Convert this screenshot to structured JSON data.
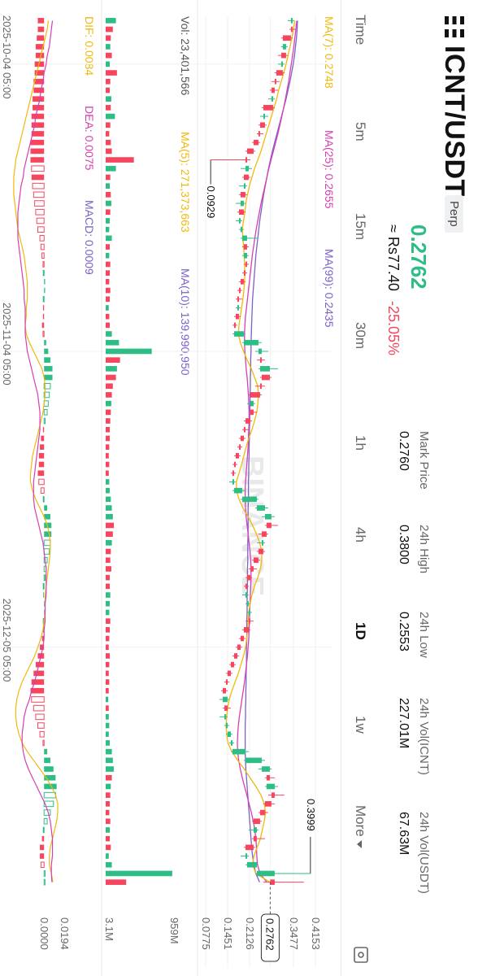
{
  "header": {
    "pair": "ICNT/USDT",
    "contract_type": "Perp",
    "last_price": "0.2762",
    "fiat_price": "≈ Rs77.40",
    "change_pct": "-25.05%"
  },
  "stats": [
    {
      "label": "Mark Price",
      "value": "0.2760"
    },
    {
      "label": "24h High",
      "value": "0.3800"
    },
    {
      "label": "24h Low",
      "value": "0.2553"
    },
    {
      "label": "24h Vol(ICNT)",
      "value": "227.01M"
    },
    {
      "label": "24h Vol(USDT)",
      "value": "67.63M"
    }
  ],
  "timeframes": [
    "Time",
    "5m",
    "15m",
    "30m",
    "1h",
    "4h",
    "1D",
    "1w",
    "More"
  ],
  "active_timeframe": "1D",
  "indicators": {
    "ma7": "MA(7): 0.2748",
    "ma25": "MA(25): 0.2655",
    "ma99": "MA(99): 0.2435",
    "vol": "Vol: 23,401,566",
    "vol_ma5": "MA(5): 271,373,663",
    "vol_ma10": "MA(10): 139,990,950",
    "dif": "DIF: 0.0084",
    "dea": "DEA: 0.0075",
    "macd": "MACD: 0.0009"
  },
  "watermark": "BINANCE",
  "colors": {
    "up": "#2ebd85",
    "down": "#f6465d",
    "ma7": "#f0b90b",
    "ma25": "#d63fb4",
    "ma99": "#7b61c9"
  },
  "chart_data": {
    "type": "candlestick",
    "x_ticks": [
      "2025-10-04 05:00",
      "2025-11-04 05:00",
      "2025-12-05 05:00"
    ],
    "price_ticks": [
      "0.4153",
      "0.3477",
      "0.2762",
      "0.2126",
      "0.1451",
      "0.0775"
    ],
    "price_ylim": [
      0.0775,
      0.4153
    ],
    "volume_ticks": [
      "959M",
      "3.1M"
    ],
    "macd_ticks": [
      "0.0194",
      "0.0000"
    ],
    "annotations": {
      "low": "0.0929",
      "high": "0.3999",
      "last": "0.2762"
    },
    "candles": [
      [
        0.34,
        0.35,
        0.33,
        0.345
      ],
      [
        0.345,
        0.355,
        0.335,
        0.34
      ],
      [
        0.34,
        0.345,
        0.31,
        0.315
      ],
      [
        0.315,
        0.33,
        0.31,
        0.325
      ],
      [
        0.325,
        0.33,
        0.3,
        0.31
      ],
      [
        0.31,
        0.32,
        0.3,
        0.315
      ],
      [
        0.315,
        0.32,
        0.29,
        0.295
      ],
      [
        0.295,
        0.305,
        0.28,
        0.29
      ],
      [
        0.29,
        0.3,
        0.275,
        0.28
      ],
      [
        0.28,
        0.29,
        0.27,
        0.285
      ],
      [
        0.285,
        0.29,
        0.25,
        0.255
      ],
      [
        0.255,
        0.27,
        0.245,
        0.26
      ],
      [
        0.26,
        0.265,
        0.24,
        0.245
      ],
      [
        0.245,
        0.255,
        0.235,
        0.24
      ],
      [
        0.24,
        0.245,
        0.22,
        0.225
      ],
      [
        0.225,
        0.23,
        0.2,
        0.205
      ],
      [
        0.205,
        0.215,
        0.0929,
        0.2
      ],
      [
        0.2,
        0.22,
        0.185,
        0.21
      ],
      [
        0.21,
        0.215,
        0.19,
        0.195
      ],
      [
        0.195,
        0.205,
        0.18,
        0.2
      ],
      [
        0.2,
        0.205,
        0.18,
        0.185
      ],
      [
        0.185,
        0.2,
        0.17,
        0.195
      ],
      [
        0.195,
        0.2,
        0.175,
        0.18
      ],
      [
        0.18,
        0.19,
        0.17,
        0.185
      ],
      [
        0.185,
        0.195,
        0.18,
        0.19
      ],
      [
        0.19,
        0.24,
        0.185,
        0.205
      ],
      [
        0.205,
        0.21,
        0.19,
        0.195
      ],
      [
        0.195,
        0.21,
        0.19,
        0.205
      ],
      [
        0.205,
        0.21,
        0.195,
        0.2
      ],
      [
        0.2,
        0.205,
        0.19,
        0.195
      ],
      [
        0.195,
        0.2,
        0.18,
        0.185
      ],
      [
        0.185,
        0.19,
        0.175,
        0.18
      ],
      [
        0.18,
        0.19,
        0.17,
        0.175
      ],
      [
        0.175,
        0.185,
        0.17,
        0.18
      ],
      [
        0.18,
        0.185,
        0.165,
        0.17
      ],
      [
        0.17,
        0.175,
        0.16,
        0.165
      ],
      [
        0.165,
        0.2,
        0.16,
        0.195
      ],
      [
        0.195,
        0.25,
        0.19,
        0.24
      ],
      [
        0.24,
        0.27,
        0.23,
        0.25
      ],
      [
        0.25,
        0.26,
        0.235,
        0.245
      ],
      [
        0.245,
        0.3,
        0.24,
        0.275
      ],
      [
        0.275,
        0.28,
        0.245,
        0.25
      ],
      [
        0.25,
        0.26,
        0.23,
        0.245
      ],
      [
        0.245,
        0.25,
        0.21,
        0.215
      ],
      [
        0.215,
        0.23,
        0.205,
        0.225
      ],
      [
        0.225,
        0.235,
        0.21,
        0.215
      ],
      [
        0.215,
        0.22,
        0.195,
        0.2
      ],
      [
        0.2,
        0.21,
        0.19,
        0.195
      ],
      [
        0.195,
        0.2,
        0.18,
        0.185
      ],
      [
        0.185,
        0.19,
        0.175,
        0.18
      ],
      [
        0.18,
        0.185,
        0.165,
        0.17
      ],
      [
        0.17,
        0.175,
        0.16,
        0.165
      ],
      [
        0.165,
        0.17,
        0.155,
        0.16
      ],
      [
        0.16,
        0.17,
        0.15,
        0.165
      ],
      [
        0.165,
        0.2,
        0.16,
        0.19
      ],
      [
        0.19,
        0.24,
        0.185,
        0.235
      ],
      [
        0.235,
        0.27,
        0.23,
        0.26
      ],
      [
        0.26,
        0.29,
        0.25,
        0.28
      ],
      [
        0.28,
        0.3,
        0.26,
        0.265
      ],
      [
        0.265,
        0.27,
        0.24,
        0.25
      ],
      [
        0.25,
        0.26,
        0.235,
        0.255
      ],
      [
        0.255,
        0.26,
        0.235,
        0.24
      ],
      [
        0.24,
        0.245,
        0.22,
        0.225
      ],
      [
        0.225,
        0.235,
        0.21,
        0.215
      ],
      [
        0.215,
        0.22,
        0.2,
        0.205
      ],
      [
        0.205,
        0.21,
        0.195,
        0.2
      ],
      [
        0.2,
        0.21,
        0.19,
        0.205
      ],
      [
        0.205,
        0.215,
        0.2,
        0.21
      ],
      [
        0.21,
        0.22,
        0.205,
        0.215
      ],
      [
        0.215,
        0.225,
        0.2,
        0.21
      ],
      [
        0.21,
        0.215,
        0.19,
        0.195
      ],
      [
        0.195,
        0.2,
        0.18,
        0.185
      ],
      [
        0.185,
        0.19,
        0.17,
        0.175
      ],
      [
        0.175,
        0.18,
        0.16,
        0.165
      ],
      [
        0.165,
        0.17,
        0.15,
        0.155
      ],
      [
        0.155,
        0.16,
        0.14,
        0.145
      ],
      [
        0.145,
        0.15,
        0.135,
        0.14
      ],
      [
        0.14,
        0.145,
        0.125,
        0.13
      ],
      [
        0.13,
        0.15,
        0.12,
        0.145
      ],
      [
        0.145,
        0.155,
        0.13,
        0.135
      ],
      [
        0.135,
        0.145,
        0.12,
        0.14
      ],
      [
        0.14,
        0.15,
        0.135,
        0.145
      ],
      [
        0.145,
        0.16,
        0.14,
        0.155
      ],
      [
        0.155,
        0.165,
        0.15,
        0.16
      ],
      [
        0.16,
        0.21,
        0.155,
        0.2
      ],
      [
        0.2,
        0.26,
        0.195,
        0.25
      ],
      [
        0.25,
        0.28,
        0.24,
        0.275
      ],
      [
        0.275,
        0.29,
        0.26,
        0.265
      ],
      [
        0.265,
        0.3,
        0.26,
        0.29
      ],
      [
        0.29,
        0.32,
        0.27,
        0.28
      ],
      [
        0.28,
        0.29,
        0.255,
        0.26
      ],
      [
        0.26,
        0.27,
        0.24,
        0.245
      ],
      [
        0.245,
        0.25,
        0.22,
        0.225
      ],
      [
        0.225,
        0.24,
        0.21,
        0.235
      ],
      [
        0.235,
        0.26,
        0.22,
        0.225
      ],
      [
        0.225,
        0.23,
        0.195,
        0.2
      ],
      [
        0.2,
        0.21,
        0.185,
        0.205
      ],
      [
        0.205,
        0.24,
        0.2,
        0.235
      ],
      [
        0.235,
        0.3999,
        0.23,
        0.29
      ],
      [
        0.29,
        0.38,
        0.255,
        0.2762
      ]
    ],
    "ma7": [
      0.352,
      0.348,
      0.343,
      0.337,
      0.331,
      0.325,
      0.318,
      0.31,
      0.302,
      0.296,
      0.288,
      0.28,
      0.272,
      0.264,
      0.256,
      0.248,
      0.238,
      0.228,
      0.22,
      0.212,
      0.206,
      0.201,
      0.198,
      0.194,
      0.19,
      0.192,
      0.194,
      0.196,
      0.197,
      0.198,
      0.197,
      0.195,
      0.192,
      0.188,
      0.184,
      0.18,
      0.178,
      0.184,
      0.194,
      0.205,
      0.218,
      0.228,
      0.238,
      0.24,
      0.238,
      0.235,
      0.228,
      0.22,
      0.21,
      0.202,
      0.195,
      0.188,
      0.18,
      0.172,
      0.172,
      0.18,
      0.192,
      0.208,
      0.222,
      0.234,
      0.244,
      0.25,
      0.25,
      0.246,
      0.238,
      0.228,
      0.22,
      0.214,
      0.21,
      0.208,
      0.206,
      0.204,
      0.2,
      0.194,
      0.186,
      0.178,
      0.168,
      0.158,
      0.15,
      0.145,
      0.142,
      0.14,
      0.142,
      0.146,
      0.158,
      0.176,
      0.196,
      0.214,
      0.232,
      0.248,
      0.258,
      0.262,
      0.258,
      0.252,
      0.246,
      0.236,
      0.226,
      0.222,
      0.232,
      0.2748
    ],
    "ma25": [
      0.358,
      0.355,
      0.352,
      0.349,
      0.345,
      0.341,
      0.337,
      0.333,
      0.328,
      0.323,
      0.318,
      0.312,
      0.306,
      0.3,
      0.293,
      0.286,
      0.279,
      0.272,
      0.266,
      0.26,
      0.254,
      0.248,
      0.243,
      0.238,
      0.233,
      0.229,
      0.225,
      0.221,
      0.218,
      0.215,
      0.212,
      0.209,
      0.206,
      0.203,
      0.2,
      0.198,
      0.197,
      0.197,
      0.198,
      0.2,
      0.202,
      0.205,
      0.207,
      0.209,
      0.21,
      0.211,
      0.211,
      0.21,
      0.209,
      0.208,
      0.206,
      0.204,
      0.202,
      0.2,
      0.199,
      0.199,
      0.2,
      0.202,
      0.205,
      0.208,
      0.211,
      0.214,
      0.216,
      0.217,
      0.217,
      0.216,
      0.215,
      0.214,
      0.213,
      0.212,
      0.211,
      0.21,
      0.208,
      0.206,
      0.203,
      0.2,
      0.197,
      0.193,
      0.189,
      0.185,
      0.181,
      0.178,
      0.176,
      0.175,
      0.176,
      0.179,
      0.184,
      0.19,
      0.197,
      0.204,
      0.211,
      0.218,
      0.224,
      0.229,
      0.232,
      0.234,
      0.235,
      0.237,
      0.245,
      0.2655
    ],
    "ma99": [
      0.36,
      0.359,
      0.357,
      0.354,
      0.351,
      0.347,
      0.342,
      0.337,
      0.331,
      0.325,
      0.318,
      0.311,
      0.304,
      0.297,
      0.29,
      0.283,
      0.277,
      0.271,
      0.266,
      0.261,
      0.256,
      0.252,
      0.248,
      0.244,
      0.241,
      0.238,
      0.235,
      0.232,
      0.23,
      0.228,
      0.226,
      0.224,
      0.222,
      0.221,
      0.22,
      0.219,
      0.218,
      0.217,
      0.217,
      0.216,
      0.216,
      0.215,
      0.215,
      0.214,
      0.214,
      0.213,
      0.213,
      0.212,
      0.212,
      0.211,
      0.211,
      0.21,
      0.21,
      0.209,
      0.209,
      0.209,
      0.208,
      0.208,
      0.208,
      0.208,
      0.207,
      0.207,
      0.207,
      0.206,
      0.206,
      0.206,
      0.205,
      0.205,
      0.205,
      0.204,
      0.204,
      0.204,
      0.203,
      0.203,
      0.203,
      0.202,
      0.202,
      0.201,
      0.201,
      0.2,
      0.2,
      0.199,
      0.199,
      0.199,
      0.199,
      0.2,
      0.201,
      0.203,
      0.205,
      0.207,
      0.209,
      0.211,
      0.213,
      0.215,
      0.217,
      0.219,
      0.222,
      0.226,
      0.232,
      0.2435
    ],
    "volume": [
      20,
      14,
      10,
      9,
      12,
      8,
      22,
      9,
      8,
      11,
      10,
      18,
      9,
      7,
      10,
      12,
      55,
      20,
      9,
      8,
      10,
      11,
      9,
      8,
      7,
      12,
      8,
      7,
      9,
      8,
      7,
      9,
      8,
      6,
      7,
      8,
      12,
      26,
      90,
      28,
      22,
      20,
      14,
      12,
      11,
      10,
      9,
      8,
      8,
      7,
      6,
      7,
      6,
      7,
      8,
      10,
      12,
      14,
      16,
      14,
      12,
      10,
      9,
      11,
      8,
      8,
      9,
      8,
      7,
      9,
      8,
      7,
      6,
      8,
      7,
      6,
      7,
      6,
      5,
      6,
      6,
      7,
      6,
      8,
      12,
      14,
      16,
      12,
      10,
      9,
      8,
      7,
      9,
      8,
      8,
      10,
      6,
      12,
      130,
      40
    ],
    "macd_hist": [
      -0.006,
      -0.006,
      -0.007,
      -0.008,
      -0.008,
      -0.009,
      -0.009,
      -0.01,
      -0.01,
      -0.011,
      -0.011,
      -0.012,
      -0.012,
      -0.012,
      -0.013,
      -0.013,
      -0.013,
      -0.012,
      -0.012,
      -0.011,
      -0.01,
      -0.009,
      -0.008,
      -0.007,
      -0.006,
      -0.004,
      -0.003,
      -0.002,
      -0.001,
      0.0,
      0.001,
      0.001,
      0.0,
      -0.001,
      -0.001,
      -0.002,
      -0.001,
      0.002,
      0.004,
      0.006,
      0.008,
      0.008,
      0.006,
      0.005,
      0.004,
      0.003,
      0.001,
      -0.001,
      -0.003,
      -0.004,
      -0.005,
      -0.005,
      -0.006,
      -0.005,
      -0.003,
      0.0,
      0.003,
      0.006,
      0.007,
      0.007,
      0.006,
      0.005,
      0.003,
      0.002,
      0.001,
      0.0,
      0.0,
      0.001,
      0.001,
      0.0,
      -0.001,
      -0.002,
      -0.004,
      -0.006,
      -0.008,
      -0.01,
      -0.012,
      -0.013,
      -0.012,
      -0.01,
      -0.008,
      -0.006,
      -0.004,
      -0.001,
      0.003,
      0.006,
      0.009,
      0.011,
      0.012,
      0.011,
      0.009,
      0.006,
      0.003,
      0.0,
      -0.002,
      -0.004,
      -0.004,
      -0.003,
      0.001,
      0.0009
    ],
    "dif": [
      0.004,
      0.003,
      0.001,
      -0.001,
      -0.003,
      -0.005,
      -0.007,
      -0.009,
      -0.011,
      -0.013,
      -0.015,
      -0.017,
      -0.019,
      -0.021,
      -0.023,
      -0.025,
      -0.027,
      -0.028,
      -0.029,
      -0.029,
      -0.029,
      -0.028,
      -0.027,
      -0.026,
      -0.025,
      -0.023,
      -0.021,
      -0.019,
      -0.018,
      -0.017,
      -0.016,
      -0.016,
      -0.016,
      -0.017,
      -0.017,
      -0.018,
      -0.017,
      -0.014,
      -0.01,
      -0.006,
      -0.002,
      0.0,
      0.001,
      0.001,
      0.0,
      -0.001,
      -0.003,
      -0.005,
      -0.007,
      -0.009,
      -0.011,
      -0.012,
      -0.013,
      -0.013,
      -0.011,
      -0.008,
      -0.004,
      0.0,
      0.003,
      0.005,
      0.006,
      0.006,
      0.005,
      0.004,
      0.003,
      0.002,
      0.001,
      0.001,
      0.001,
      0.0,
      -0.001,
      -0.003,
      -0.006,
      -0.009,
      -0.013,
      -0.017,
      -0.021,
      -0.024,
      -0.026,
      -0.027,
      -0.027,
      -0.026,
      -0.024,
      -0.021,
      -0.016,
      -0.01,
      -0.004,
      0.002,
      0.007,
      0.011,
      0.013,
      0.013,
      0.012,
      0.01,
      0.008,
      0.006,
      0.005,
      0.005,
      0.007,
      0.0084
    ],
    "dea": [
      0.008,
      0.007,
      0.006,
      0.005,
      0.003,
      0.002,
      0.0,
      -0.001,
      -0.003,
      -0.004,
      -0.006,
      -0.008,
      -0.009,
      -0.011,
      -0.013,
      -0.015,
      -0.017,
      -0.019,
      -0.02,
      -0.022,
      -0.023,
      -0.024,
      -0.025,
      -0.025,
      -0.025,
      -0.025,
      -0.024,
      -0.023,
      -0.022,
      -0.021,
      -0.02,
      -0.019,
      -0.019,
      -0.018,
      -0.018,
      -0.018,
      -0.018,
      -0.017,
      -0.016,
      -0.014,
      -0.012,
      -0.01,
      -0.008,
      -0.006,
      -0.005,
      -0.004,
      -0.004,
      -0.004,
      -0.005,
      -0.006,
      -0.007,
      -0.008,
      -0.009,
      -0.01,
      -0.01,
      -0.01,
      -0.009,
      -0.007,
      -0.005,
      -0.003,
      -0.001,
      0.0,
      0.001,
      0.002,
      0.002,
      0.002,
      0.002,
      0.001,
      0.001,
      0.001,
      0.0,
      0.0,
      -0.001,
      -0.003,
      -0.005,
      -0.007,
      -0.009,
      -0.012,
      -0.014,
      -0.017,
      -0.019,
      -0.02,
      -0.021,
      -0.021,
      -0.02,
      -0.018,
      -0.015,
      -0.011,
      -0.007,
      -0.003,
      0.001,
      0.004,
      0.006,
      0.007,
      0.008,
      0.008,
      0.008,
      0.007,
      0.007,
      0.0075
    ]
  }
}
